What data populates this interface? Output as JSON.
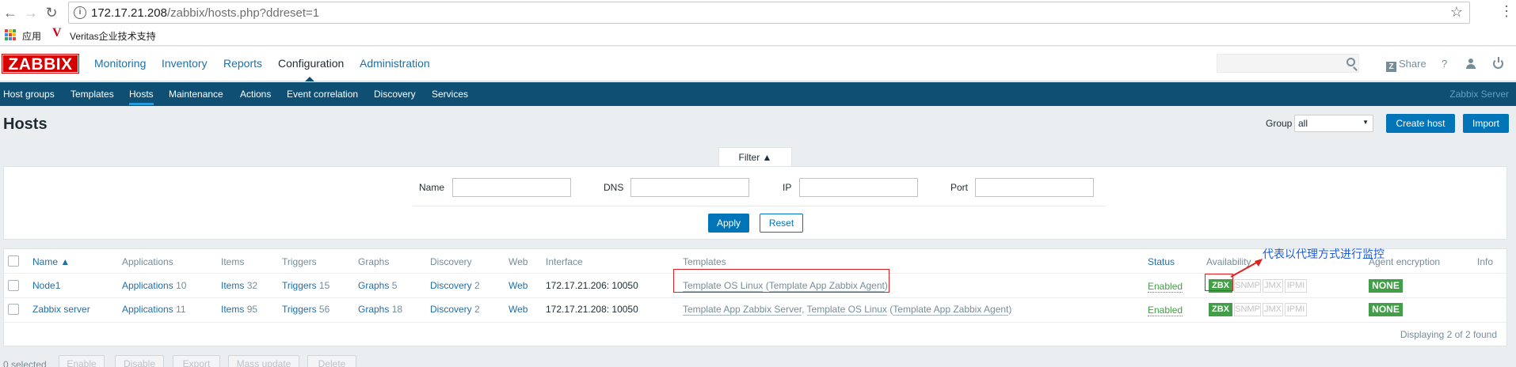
{
  "browser": {
    "url_host": "172.17.21.208",
    "url_path": "/zabbix/hosts.php?ddreset=1",
    "bookmarks": [
      "应用",
      "Veritas企业技术支持"
    ]
  },
  "header": {
    "logo": "ZABBIX",
    "menu": [
      "Monitoring",
      "Inventory",
      "Reports",
      "Configuration",
      "Administration"
    ],
    "share": "Share",
    "help": "?",
    "search_placeholder": ""
  },
  "subnav": {
    "items": [
      "Host groups",
      "Templates",
      "Hosts",
      "Maintenance",
      "Actions",
      "Event correlation",
      "Discovery",
      "Services"
    ],
    "server": "Zabbix Server"
  },
  "page": {
    "title": "Hosts",
    "group_label": "Group",
    "group_value": "all",
    "create_host": "Create host",
    "import": "Import"
  },
  "filter": {
    "tab": "Filter ▲",
    "name_label": "Name",
    "dns_label": "DNS",
    "ip_label": "IP",
    "port_label": "Port",
    "apply": "Apply",
    "reset": "Reset"
  },
  "table": {
    "columns": [
      "Name ▲",
      "Applications",
      "Items",
      "Triggers",
      "Graphs",
      "Discovery",
      "Web",
      "Interface",
      "Templates",
      "Status",
      "Availability",
      "Agent encryption",
      "Info"
    ],
    "rows": [
      {
        "name": "Node1",
        "applications": "Applications",
        "applications_count": "10",
        "items": "Items",
        "items_count": "32",
        "triggers": "Triggers",
        "triggers_count": "15",
        "graphs": "Graphs",
        "graphs_count": "5",
        "discovery": "Discovery",
        "discovery_count": "2",
        "web": "Web",
        "interface": "172.17.21.206: 10050",
        "tpl_main": "Template OS Linux",
        "tpl_paren_open": " (",
        "tpl_sub": "Template App Zabbix Agent",
        "tpl_paren_close": ")",
        "status": "Enabled",
        "zbx": "ZBX",
        "snmp": "SNMP",
        "jmx": "JMX",
        "ipmi": "IPMI",
        "encryption": "NONE"
      },
      {
        "name": "Zabbix server",
        "applications": "Applications",
        "applications_count": "11",
        "items": "Items",
        "items_count": "95",
        "triggers": "Triggers",
        "triggers_count": "56",
        "graphs": "Graphs",
        "graphs_count": "18",
        "discovery": "Discovery",
        "discovery_count": "2",
        "web": "Web",
        "interface": "172.17.21.208: 10050",
        "tpl_main": "Template App Zabbix Server",
        "tpl_sep": ", ",
        "tpl_main2": "Template OS Linux",
        "tpl_paren_open": " (",
        "tpl_sub": "Template App Zabbix Agent",
        "tpl_paren_close": ")",
        "status": "Enabled",
        "zbx": "ZBX",
        "snmp": "SNMP",
        "jmx": "JMX",
        "ipmi": "IPMI",
        "encryption": "NONE"
      }
    ],
    "displaying": "Displaying 2 of 2 found"
  },
  "annotation": "代表以代理方式进行监控",
  "footer": {
    "selected": "0 selected",
    "buttons": [
      "Enable",
      "Disable",
      "Export",
      "Mass update",
      "Delete"
    ]
  },
  "colors": {
    "brand_red": "#d40000",
    "subnav_blue": "#0e4f73",
    "link_blue": "#1f6fa8",
    "ok_green": "#429e47",
    "annotation_red": "#e02020"
  }
}
